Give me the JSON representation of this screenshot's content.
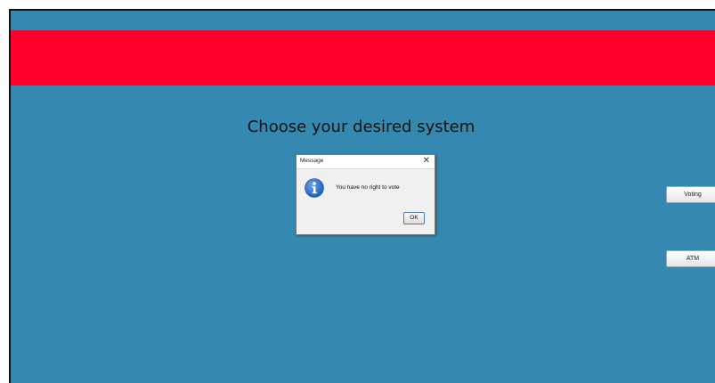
{
  "colors": {
    "background": "#3589b0",
    "banner": "#ff002c"
  },
  "main": {
    "heading": "Choose your desired system",
    "buttons": {
      "voting": "Voting",
      "atm": "ATM"
    }
  },
  "dialog": {
    "title": "Message",
    "close": "✕",
    "icon": "info-icon",
    "message": "You have no right to vote",
    "ok": "OK"
  }
}
